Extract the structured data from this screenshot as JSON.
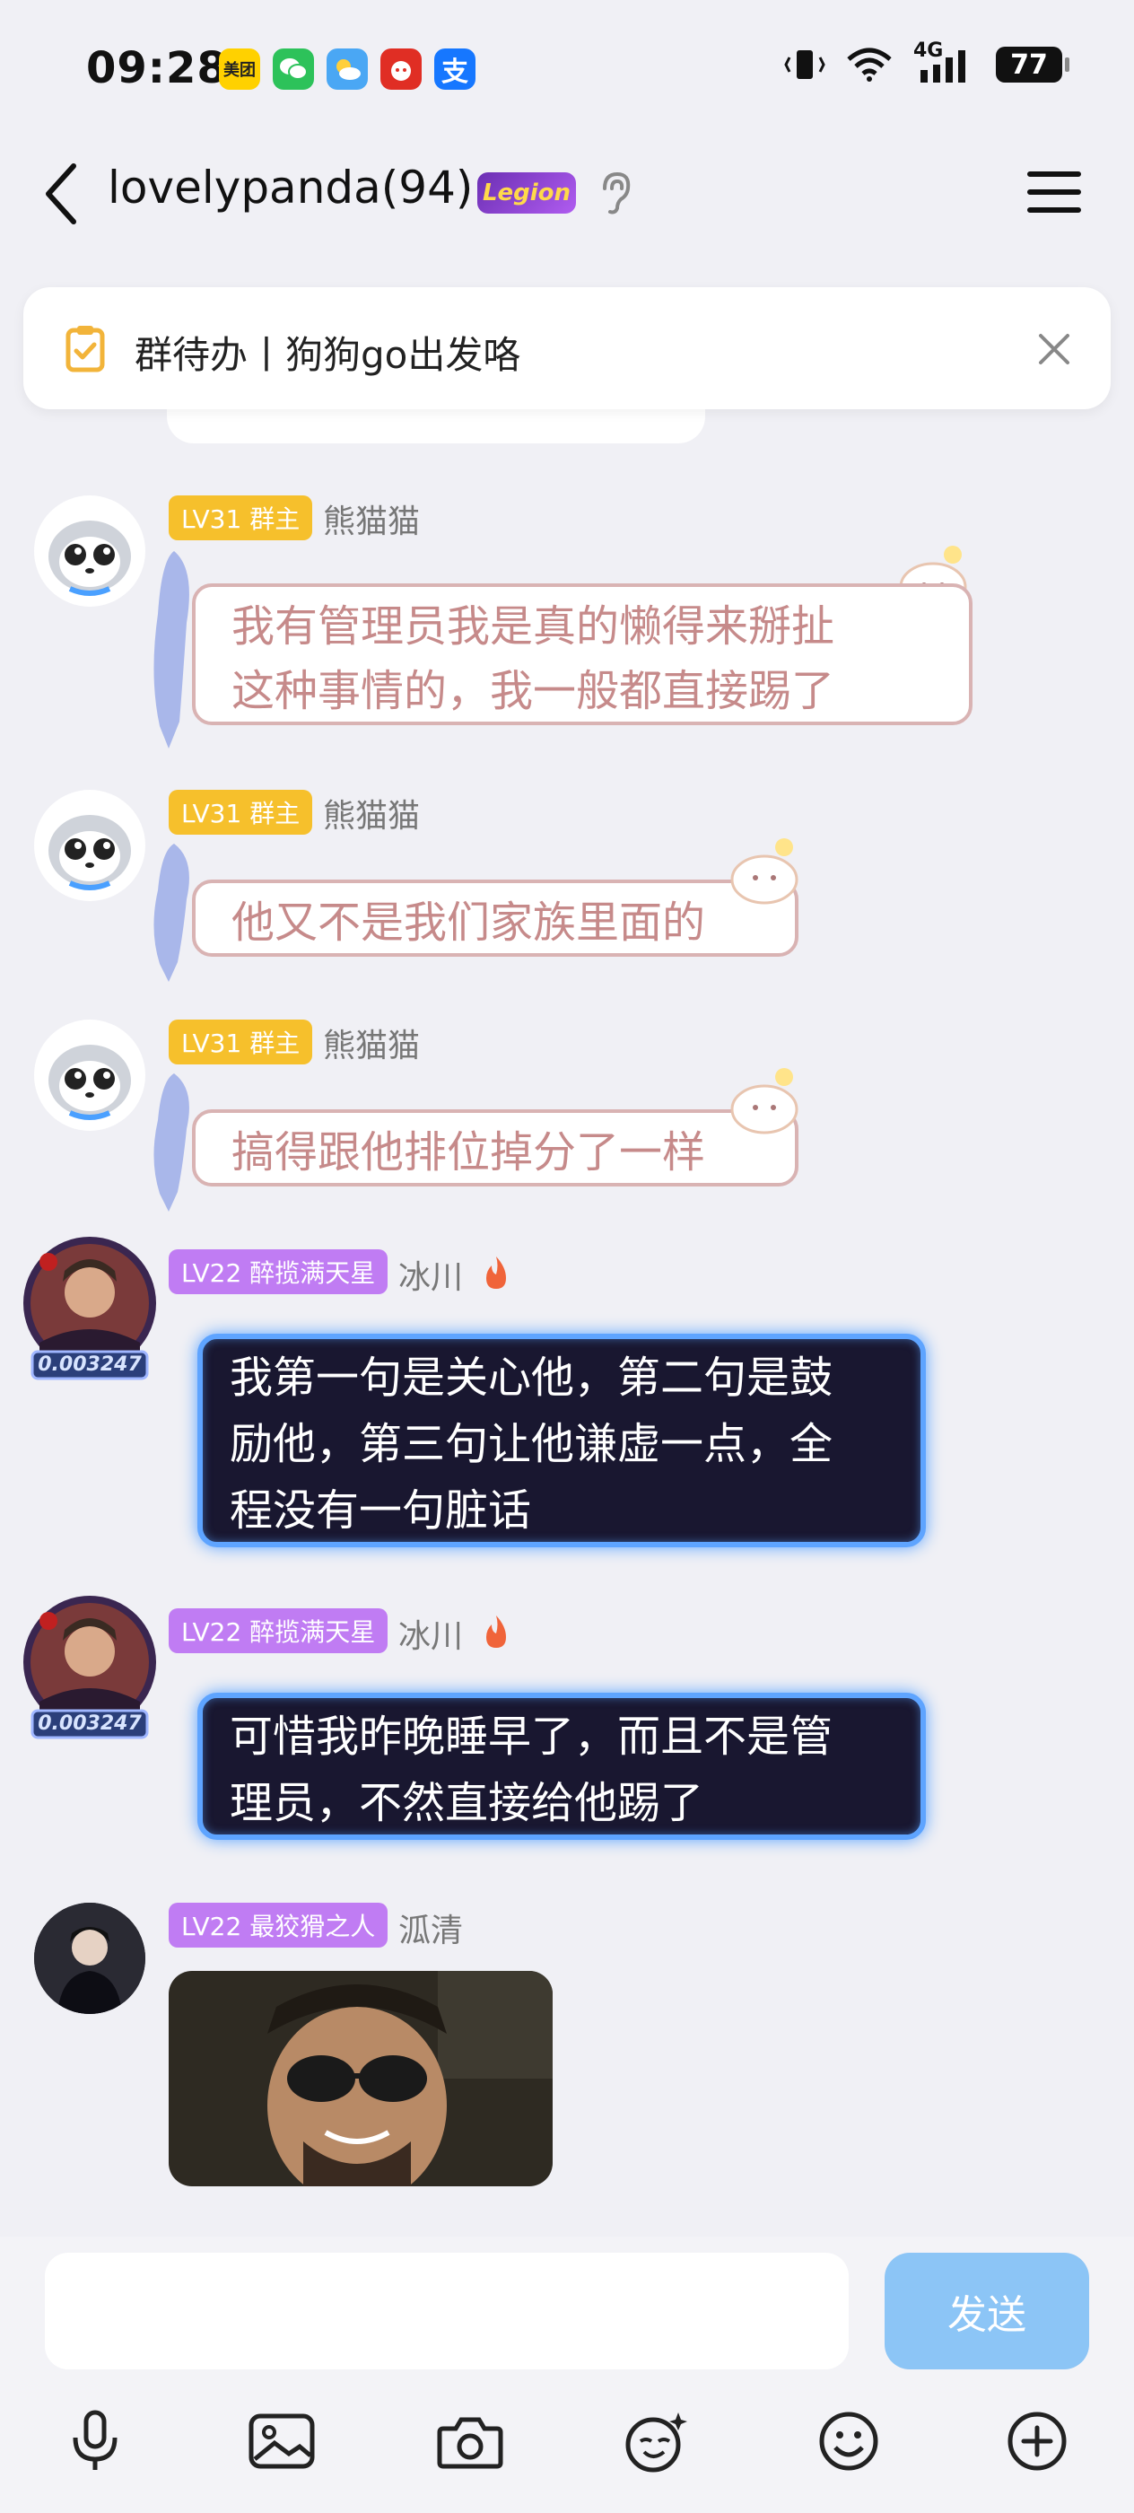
{
  "status_bar": {
    "time": "09:28",
    "apps": [
      {
        "name": "meituan-icon",
        "label": "美团",
        "color": "#ffd100",
        "text_color": "#222"
      },
      {
        "name": "wechat-icon",
        "label": "",
        "color": "#2dc25a",
        "text_color": "#fff"
      },
      {
        "name": "weather-icon",
        "label": "",
        "color": "#4aa7f4",
        "text_color": "#fff"
      },
      {
        "name": "pinduoduo-icon",
        "label": "",
        "color": "#e02e24",
        "text_color": "#fff"
      },
      {
        "name": "alipay-icon",
        "label": "支",
        "color": "#1677ff",
        "text_color": "#fff"
      }
    ],
    "network": "4G",
    "battery": "77"
  },
  "header": {
    "title": "lovelypanda(94)",
    "badge": "Legion"
  },
  "todo": {
    "text": "群待办丨狗狗go出发咯"
  },
  "messages": [
    {
      "level": "LV31 群主",
      "sender": "熊猫猫",
      "text_lines": [
        "我有管理员我是真的懒得来掰扯",
        "这种事情的，我一般都直接踢了"
      ]
    },
    {
      "level": "LV31 群主",
      "sender": "熊猫猫",
      "text_lines": [
        "他又不是我们家族里面的"
      ]
    },
    {
      "level": "LV31 群主",
      "sender": "熊猫猫",
      "text_lines": [
        "搞得跟他排位掉分了一样"
      ]
    },
    {
      "level": "LV22 醉揽满天星",
      "sender": "冰川",
      "avatar_text": "0.003247",
      "text_lines": [
        "我第一句是关心他，第二句是鼓",
        "励他，第三句让他谦虚一点，全",
        "程没有一句脏话"
      ]
    },
    {
      "level": "LV22 醉揽满天星",
      "sender": "冰川",
      "avatar_text": "0.003247",
      "text_lines": [
        "可惜我昨晚睡早了，而且不是管",
        "理员，不然直接给他踢了"
      ]
    },
    {
      "level": "LV22 最狡猾之人",
      "sender": "泒清"
    }
  ],
  "input": {
    "placeholder": "",
    "send_label": "发送"
  },
  "colors": {
    "owner_badge": "#f6c02c",
    "member_badge": "#c07cf3",
    "send_button": "#8cc5f6",
    "dark_bubble_glow": "#5ea4ff"
  }
}
